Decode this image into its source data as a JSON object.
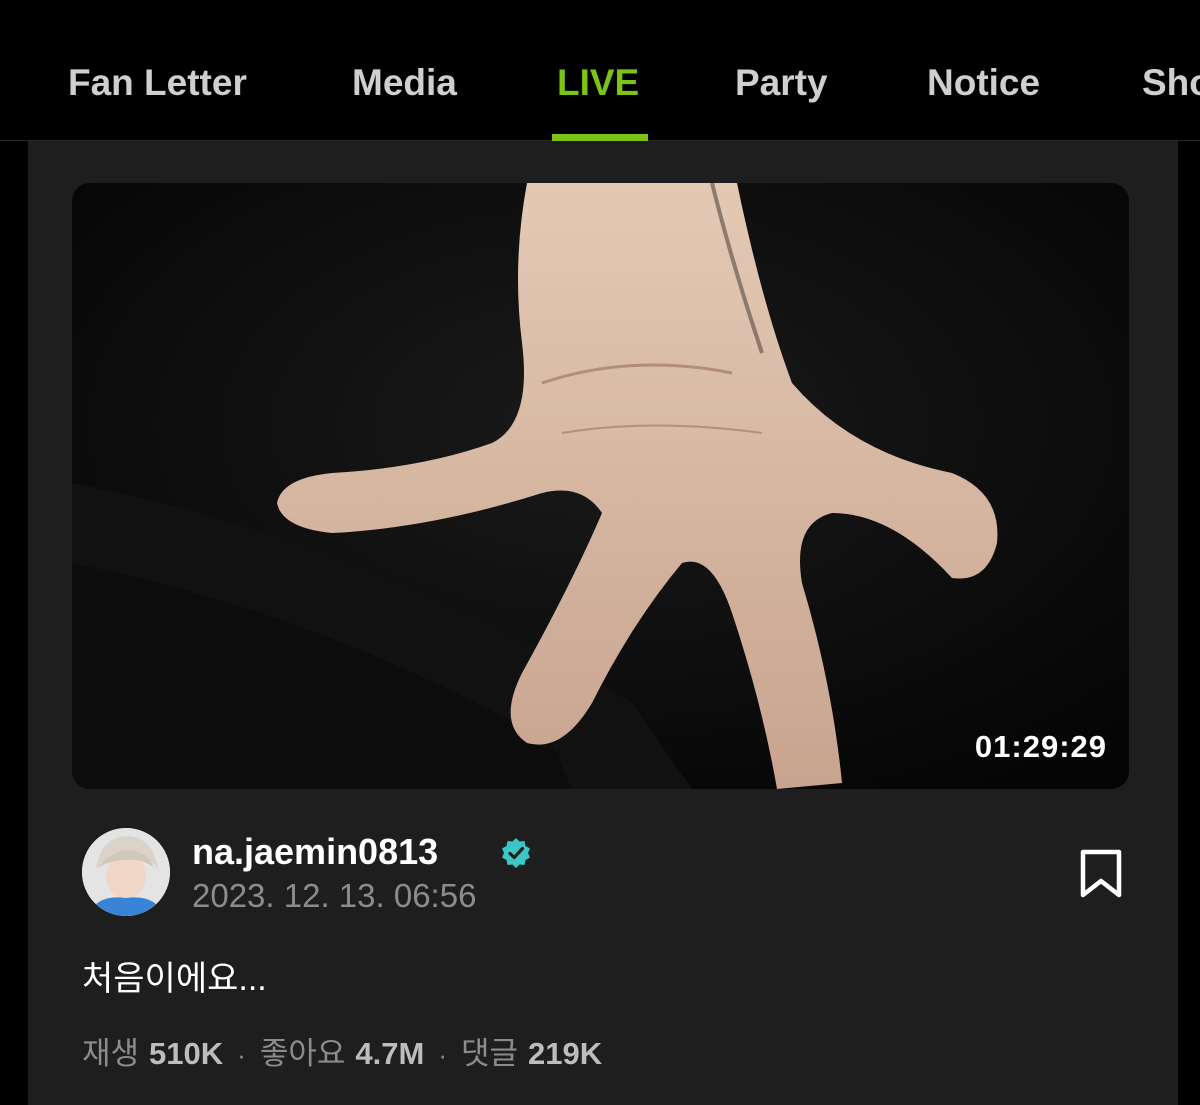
{
  "tabs": [
    {
      "label": "Fan Letter",
      "active": false
    },
    {
      "label": "Media",
      "active": false
    },
    {
      "label": "LIVE",
      "active": true
    },
    {
      "label": "Party",
      "active": false
    },
    {
      "label": "Notice",
      "active": false
    },
    {
      "label": "Sho",
      "active": false
    }
  ],
  "post": {
    "duration": "01:29:29",
    "username": "na.jaemin0813",
    "verified": true,
    "timestamp": "2023. 12. 13. 06:56",
    "caption": "처음이에요...",
    "stats": {
      "plays_label": "재생",
      "plays_value": "510K",
      "likes_label": "좋아요",
      "likes_value": "4.7M",
      "comments_label": "댓글",
      "comments_value": "219K"
    }
  },
  "icons": {
    "verified": "verified-check-icon",
    "bookmark": "bookmark-icon"
  },
  "colors": {
    "accent": "#7cc317",
    "verified": "#3cc6c6",
    "background": "#000000",
    "card": "#1e1e1e"
  }
}
